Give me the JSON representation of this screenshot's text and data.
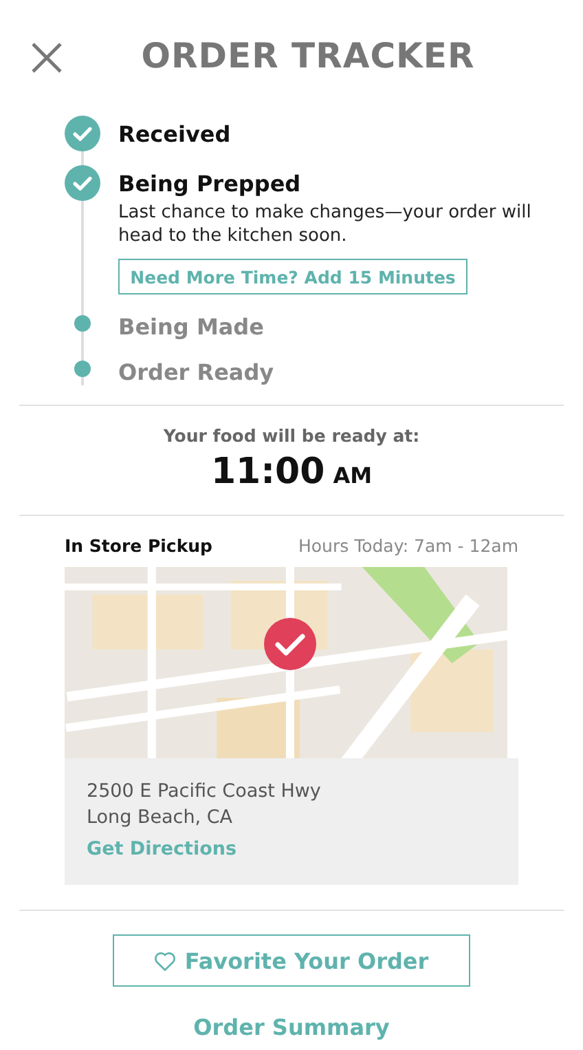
{
  "header": {
    "title": "ORDER TRACKER"
  },
  "steps": [
    {
      "label": "Received",
      "done": true
    },
    {
      "label": "Being Prepped",
      "done": true,
      "description": "Last chance to make changes—your order will head to the kitchen soon.",
      "action": "Need More Time? Add 15 Minutes"
    },
    {
      "label": "Being Made",
      "done": false
    },
    {
      "label": "Order Ready",
      "done": false
    }
  ],
  "ready": {
    "caption": "Your food will be ready at:",
    "time": "11:00",
    "period": "AM"
  },
  "pickup": {
    "method": "In Store Pickup",
    "hours": "Hours Today: 7am - 12am",
    "address_line_1": "2500 E Pacific Coast Hwy",
    "address_line_2": "Long Beach, CA",
    "directions": "Get Directions"
  },
  "favorite_button": "Favorite Your Order",
  "summary_link": "Order Summary"
}
